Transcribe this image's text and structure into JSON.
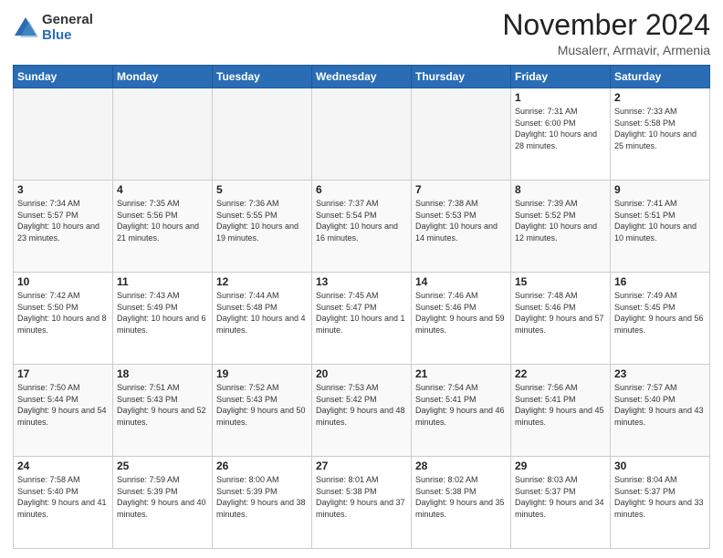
{
  "header": {
    "logo": {
      "general": "General",
      "blue": "Blue"
    },
    "title": "November 2024",
    "location": "Musalerr, Armavir, Armenia"
  },
  "calendar": {
    "days_of_week": [
      "Sunday",
      "Monday",
      "Tuesday",
      "Wednesday",
      "Thursday",
      "Friday",
      "Saturday"
    ],
    "weeks": [
      [
        {
          "day": "",
          "info": ""
        },
        {
          "day": "",
          "info": ""
        },
        {
          "day": "",
          "info": ""
        },
        {
          "day": "",
          "info": ""
        },
        {
          "day": "",
          "info": ""
        },
        {
          "day": "1",
          "info": "Sunrise: 7:31 AM\nSunset: 6:00 PM\nDaylight: 10 hours and 28 minutes."
        },
        {
          "day": "2",
          "info": "Sunrise: 7:33 AM\nSunset: 5:58 PM\nDaylight: 10 hours and 25 minutes."
        }
      ],
      [
        {
          "day": "3",
          "info": "Sunrise: 7:34 AM\nSunset: 5:57 PM\nDaylight: 10 hours and 23 minutes."
        },
        {
          "day": "4",
          "info": "Sunrise: 7:35 AM\nSunset: 5:56 PM\nDaylight: 10 hours and 21 minutes."
        },
        {
          "day": "5",
          "info": "Sunrise: 7:36 AM\nSunset: 5:55 PM\nDaylight: 10 hours and 19 minutes."
        },
        {
          "day": "6",
          "info": "Sunrise: 7:37 AM\nSunset: 5:54 PM\nDaylight: 10 hours and 16 minutes."
        },
        {
          "day": "7",
          "info": "Sunrise: 7:38 AM\nSunset: 5:53 PM\nDaylight: 10 hours and 14 minutes."
        },
        {
          "day": "8",
          "info": "Sunrise: 7:39 AM\nSunset: 5:52 PM\nDaylight: 10 hours and 12 minutes."
        },
        {
          "day": "9",
          "info": "Sunrise: 7:41 AM\nSunset: 5:51 PM\nDaylight: 10 hours and 10 minutes."
        }
      ],
      [
        {
          "day": "10",
          "info": "Sunrise: 7:42 AM\nSunset: 5:50 PM\nDaylight: 10 hours and 8 minutes."
        },
        {
          "day": "11",
          "info": "Sunrise: 7:43 AM\nSunset: 5:49 PM\nDaylight: 10 hours and 6 minutes."
        },
        {
          "day": "12",
          "info": "Sunrise: 7:44 AM\nSunset: 5:48 PM\nDaylight: 10 hours and 4 minutes."
        },
        {
          "day": "13",
          "info": "Sunrise: 7:45 AM\nSunset: 5:47 PM\nDaylight: 10 hours and 1 minute."
        },
        {
          "day": "14",
          "info": "Sunrise: 7:46 AM\nSunset: 5:46 PM\nDaylight: 9 hours and 59 minutes."
        },
        {
          "day": "15",
          "info": "Sunrise: 7:48 AM\nSunset: 5:46 PM\nDaylight: 9 hours and 57 minutes."
        },
        {
          "day": "16",
          "info": "Sunrise: 7:49 AM\nSunset: 5:45 PM\nDaylight: 9 hours and 56 minutes."
        }
      ],
      [
        {
          "day": "17",
          "info": "Sunrise: 7:50 AM\nSunset: 5:44 PM\nDaylight: 9 hours and 54 minutes."
        },
        {
          "day": "18",
          "info": "Sunrise: 7:51 AM\nSunset: 5:43 PM\nDaylight: 9 hours and 52 minutes."
        },
        {
          "day": "19",
          "info": "Sunrise: 7:52 AM\nSunset: 5:43 PM\nDaylight: 9 hours and 50 minutes."
        },
        {
          "day": "20",
          "info": "Sunrise: 7:53 AM\nSunset: 5:42 PM\nDaylight: 9 hours and 48 minutes."
        },
        {
          "day": "21",
          "info": "Sunrise: 7:54 AM\nSunset: 5:41 PM\nDaylight: 9 hours and 46 minutes."
        },
        {
          "day": "22",
          "info": "Sunrise: 7:56 AM\nSunset: 5:41 PM\nDaylight: 9 hours and 45 minutes."
        },
        {
          "day": "23",
          "info": "Sunrise: 7:57 AM\nSunset: 5:40 PM\nDaylight: 9 hours and 43 minutes."
        }
      ],
      [
        {
          "day": "24",
          "info": "Sunrise: 7:58 AM\nSunset: 5:40 PM\nDaylight: 9 hours and 41 minutes."
        },
        {
          "day": "25",
          "info": "Sunrise: 7:59 AM\nSunset: 5:39 PM\nDaylight: 9 hours and 40 minutes."
        },
        {
          "day": "26",
          "info": "Sunrise: 8:00 AM\nSunset: 5:39 PM\nDaylight: 9 hours and 38 minutes."
        },
        {
          "day": "27",
          "info": "Sunrise: 8:01 AM\nSunset: 5:38 PM\nDaylight: 9 hours and 37 minutes."
        },
        {
          "day": "28",
          "info": "Sunrise: 8:02 AM\nSunset: 5:38 PM\nDaylight: 9 hours and 35 minutes."
        },
        {
          "day": "29",
          "info": "Sunrise: 8:03 AM\nSunset: 5:37 PM\nDaylight: 9 hours and 34 minutes."
        },
        {
          "day": "30",
          "info": "Sunrise: 8:04 AM\nSunset: 5:37 PM\nDaylight: 9 hours and 33 minutes."
        }
      ]
    ]
  }
}
